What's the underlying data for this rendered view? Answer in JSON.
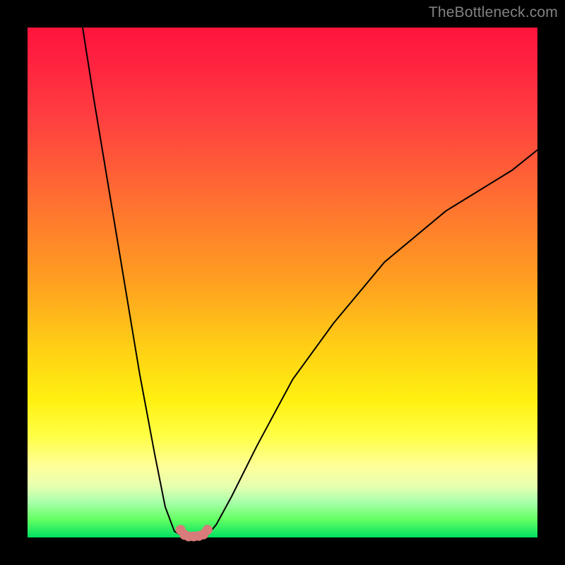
{
  "watermark": "TheBottleneck.com",
  "colors": {
    "page_bg": "#000000",
    "gradient_top": "#ff143c",
    "gradient_bottom": "#00e060",
    "curve_stroke": "#000000",
    "marker_fill": "#d97b7b",
    "marker_stroke": "#a04848",
    "watermark": "#828282"
  },
  "chart_data": {
    "type": "line",
    "title": "",
    "xlabel": "",
    "ylabel": "",
    "xlim": [
      0,
      100
    ],
    "ylim": [
      0,
      100
    ],
    "grid": false,
    "legend": false,
    "series": [
      {
        "name": "left-branch",
        "x": [
          10.8,
          13,
          16,
          19,
          22,
          25,
          27,
          28.8,
          30.0,
          30.8
        ],
        "y": [
          100,
          86,
          68,
          50,
          32,
          16,
          6,
          1.2,
          0.5,
          0.2
        ]
      },
      {
        "name": "right-branch",
        "x": [
          34.5,
          35.5,
          37,
          40,
          45,
          52,
          60,
          70,
          82,
          95,
          100
        ],
        "y": [
          0.2,
          0.7,
          2.5,
          8,
          18,
          31,
          42,
          54,
          64,
          72,
          76
        ]
      },
      {
        "name": "valley-segment",
        "x": [
          30.0,
          30.8,
          31.6,
          32.6,
          33.6,
          34.5,
          35.3
        ],
        "y": [
          1.5,
          0.5,
          0.2,
          0.2,
          0.3,
          0.6,
          1.5
        ]
      }
    ],
    "markers": {
      "series": "valley-segment",
      "x": [
        30.0,
        30.8,
        31.6,
        32.6,
        33.6,
        34.5,
        35.3
      ],
      "y": [
        1.5,
        0.5,
        0.2,
        0.2,
        0.3,
        0.6,
        1.5
      ],
      "shape": "circle",
      "radius_px": 7
    },
    "annotations": []
  }
}
